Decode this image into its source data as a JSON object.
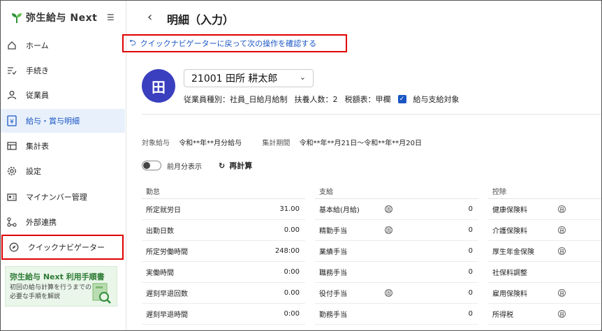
{
  "app": {
    "name": "弥生給与 Next"
  },
  "sidebar": {
    "items": [
      {
        "label": "ホーム",
        "icon": "home-icon"
      },
      {
        "label": "手続き",
        "icon": "list-check-icon"
      },
      {
        "label": "従業員",
        "icon": "person-icon"
      },
      {
        "label": "給与・賞与明細",
        "icon": "yen-icon"
      },
      {
        "label": "集計表",
        "icon": "table-icon"
      },
      {
        "label": "設定",
        "icon": "gear-icon"
      },
      {
        "label": "マイナンバー管理",
        "icon": "id-card-icon"
      },
      {
        "label": "外部連携",
        "icon": "connect-icon"
      },
      {
        "label": "クイックナビゲーター",
        "icon": "compass-icon"
      }
    ],
    "guide": {
      "title": "弥生給与 Next 利用手順書",
      "subtitle": "初回の給与計算を行うまでの必要な手順を解説"
    }
  },
  "header": {
    "back_icon": "chevron-left-icon",
    "title": "明細（入力）"
  },
  "quick_nav_link": "クイックナビゲーターに戻って次の操作を確認する",
  "employee": {
    "avatar": "田",
    "selected": "21001 田所 耕太郎",
    "type": "従業員種別：社員_日給月給制",
    "dependents": "扶養人数：2",
    "tax_table": "税額表：甲欄",
    "payroll_target_label": "給与支給対象",
    "payroll_target_checked": true
  },
  "period": {
    "target_label": "対象給与",
    "target_value": "令和**年**月分給与",
    "range_label": "集計期間",
    "range_value": "令和**年**月21日～令和**年**月20日"
  },
  "controls": {
    "prev_month_label": "前月分表示",
    "recalc_label": "再計算"
  },
  "attendance": {
    "header": "勤怠",
    "rows": [
      {
        "label": "所定就労日",
        "value": "31.00"
      },
      {
        "label": "出勤日数",
        "value": "0.00"
      },
      {
        "label": "所定労働時間",
        "value": "248:00"
      },
      {
        "label": "実働時間",
        "value": "0:00"
      },
      {
        "label": "遅刻早退回数",
        "value": "0.00"
      },
      {
        "label": "遅刻早退時間",
        "value": "0:00"
      }
    ]
  },
  "payment": {
    "header": "支給",
    "rows": [
      {
        "label": "基本給(月給)",
        "value": "0",
        "tag": "固"
      },
      {
        "label": "精勤手当",
        "value": "0",
        "tag": "固"
      },
      {
        "label": "業績手当",
        "value": "0",
        "tag": ""
      },
      {
        "label": "職務手当",
        "value": "0",
        "tag": ""
      },
      {
        "label": "役付手当",
        "value": "0",
        "tag": "固"
      },
      {
        "label": "勤務手当",
        "value": "0",
        "tag": ""
      }
    ]
  },
  "deduction": {
    "header": "控除",
    "rows": [
      {
        "label": "健康保険料",
        "tag": "自"
      },
      {
        "label": "介護保険料",
        "tag": "自"
      },
      {
        "label": "厚生年金保険",
        "tag": "自"
      },
      {
        "label": "社保料調整",
        "tag": ""
      },
      {
        "label": "雇用保険料",
        "tag": "自"
      },
      {
        "label": "所得税",
        "tag": "自"
      }
    ]
  },
  "colors": {
    "accent": "#1a56c4",
    "highlight": "#e00000",
    "avatar": "#3a3fbf",
    "active_bg": "#e8f0fb"
  }
}
